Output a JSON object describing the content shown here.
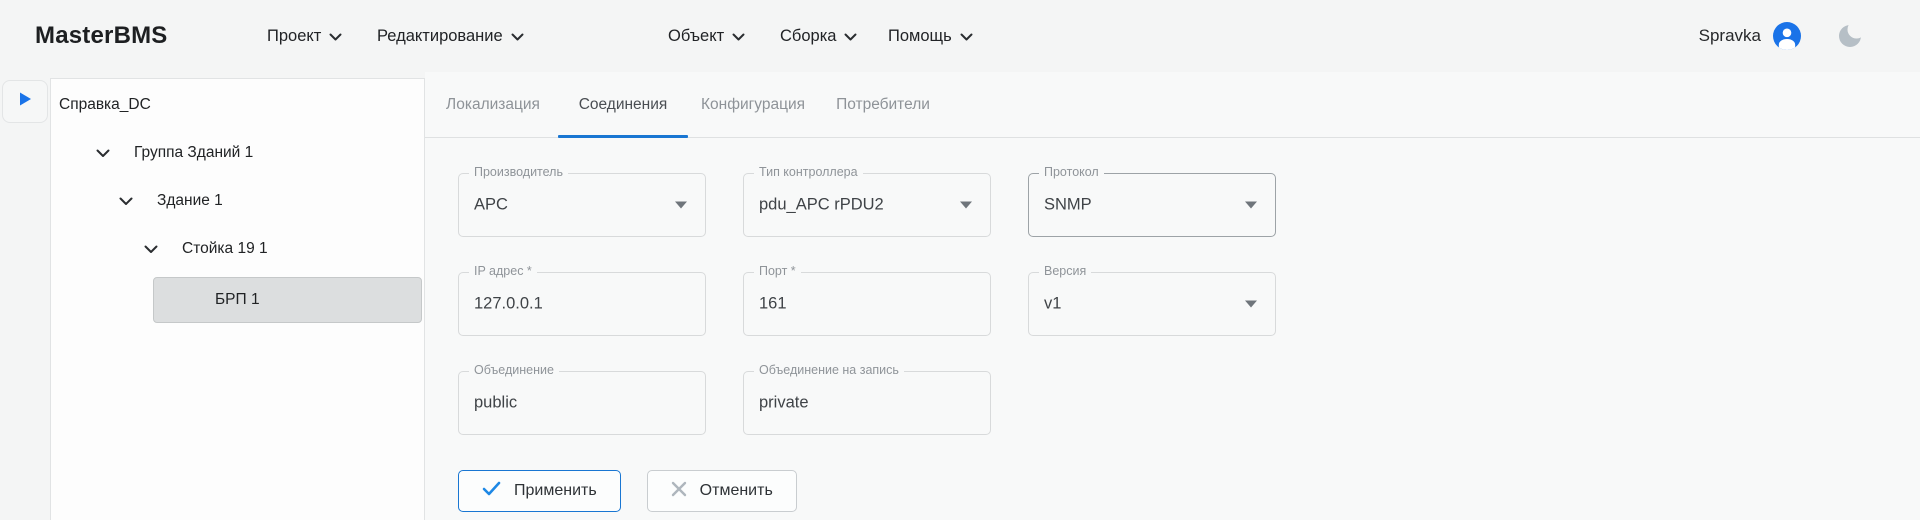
{
  "topbar": {
    "logo": "MasterBMS",
    "menus": [
      {
        "label": "Проект"
      },
      {
        "label": "Редактирование"
      },
      {
        "label": "Объект"
      },
      {
        "label": "Сборка"
      },
      {
        "label": "Помощь"
      }
    ],
    "user": "Spravka"
  },
  "sidebar": {
    "tree": {
      "root": "Справка_DC",
      "nodes": [
        {
          "label": "Группа Зданий 1",
          "expanded": true
        },
        {
          "label": "Здание 1",
          "expanded": true
        },
        {
          "label": "Стойка 19 1",
          "expanded": true
        },
        {
          "label": "БРП 1",
          "selected": true
        }
      ]
    }
  },
  "tabs": [
    {
      "label": "Локализация",
      "active": false
    },
    {
      "label": "Соединения",
      "active": true
    },
    {
      "label": "Конфигурация",
      "active": false
    },
    {
      "label": "Потребители",
      "active": false
    }
  ],
  "form": {
    "fields": [
      {
        "label": "Производитель",
        "value": "APC",
        "type": "select"
      },
      {
        "label": "Тип контроллера",
        "value": "pdu_APC rPDU2",
        "type": "select"
      },
      {
        "label": "Протокол",
        "value": "SNMP",
        "type": "select"
      },
      {
        "label": "IP адрес *",
        "value": "127.0.0.1",
        "type": "text"
      },
      {
        "label": "Порт *",
        "value": "161",
        "type": "text"
      },
      {
        "label": "Версия",
        "value": "v1",
        "type": "select"
      },
      {
        "label": "Объединение",
        "value": "public",
        "type": "text"
      },
      {
        "label": "Объединение на запись",
        "value": "private",
        "type": "text"
      }
    ],
    "buttons": {
      "apply": "Применить",
      "cancel": "Отменить"
    }
  },
  "colors": {
    "accent": "#1976d2",
    "avatar_blue": "#1a73e8",
    "moon_gray": "#b6bfc6",
    "selected_item_bg": "#dcdedf"
  }
}
